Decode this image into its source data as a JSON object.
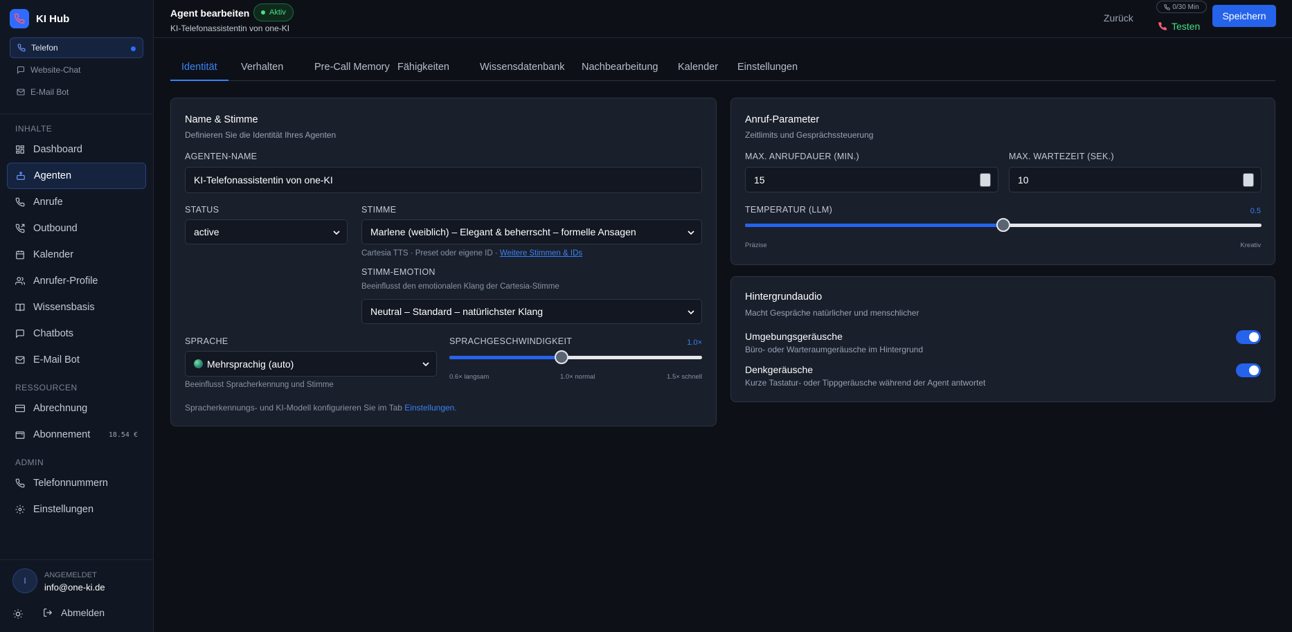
{
  "app": {
    "name": "KI Hub"
  },
  "channels": [
    {
      "label": "Telefon",
      "icon": "phone-icon"
    },
    {
      "label": "Website-Chat",
      "icon": "chat-icon"
    },
    {
      "label": "E-Mail Bot",
      "icon": "mail-icon"
    }
  ],
  "sidebar": {
    "sections": {
      "content": "INHALTE",
      "resources": "RESSOURCEN",
      "admin": "ADMIN"
    },
    "items": [
      {
        "label": "Dashboard"
      },
      {
        "label": "Agenten"
      },
      {
        "label": "Anrufe"
      },
      {
        "label": "Outbound"
      },
      {
        "label": "Kalender"
      },
      {
        "label": "Anrufer-Profile"
      },
      {
        "label": "Wissensbasis"
      },
      {
        "label": "Chatbots"
      },
      {
        "label": "E-Mail Bot"
      },
      {
        "label": "Abrechnung"
      },
      {
        "label": "Abonnement",
        "badge": "18.54 €"
      },
      {
        "label": "Telefonnummern"
      },
      {
        "label": "Einstellungen"
      }
    ],
    "account": {
      "avatar": "I",
      "label": "ANGEMELDET",
      "email": "info@one-ki.de",
      "logout": "Abmelden"
    }
  },
  "header": {
    "title": "Agent bearbeiten",
    "status_badge": "Aktiv",
    "subtitle": "KI-Telefonassistentin von one-KI",
    "back": "Zurück",
    "minutes": "0/30 Min",
    "test": "Testen",
    "save": "Speichern"
  },
  "tabs": [
    {
      "label": "Identität"
    },
    {
      "label": "Verhalten"
    },
    {
      "label": "Pre-Call Memory"
    },
    {
      "label": "Fähigkeiten"
    },
    {
      "label": "Wissensdatenbank"
    },
    {
      "label": "Nachbearbeitung"
    },
    {
      "label": "Kalender"
    },
    {
      "label": "Einstellungen"
    }
  ],
  "identity": {
    "title": "Name & Stimme",
    "subtitle": "Definieren Sie die Identität Ihres Agenten",
    "name_label": "AGENTEN-NAME",
    "name_value": "KI-Telefonassistentin von one-KI",
    "status_label": "STATUS",
    "status_value": "active",
    "voice_label": "STIMME",
    "voice_value": "Marlene (weiblich) – Elegant & beherrscht – formelle Ansagen",
    "voice_hint": "Cartesia TTS · Preset oder eigene ID · ",
    "voice_link": "Weitere Stimmen & IDs",
    "emotion_label": "STIMM-EMOTION",
    "emotion_hint": "Beeinflusst den emotionalen Klang der Cartesia-Stimme",
    "emotion_value": "Neutral – Standard – natürlichster Klang",
    "language_label": "SPRACHE",
    "language_value": "Mehrsprachig (auto)",
    "language_hint": "Beeinflusst Spracherkennung und Stimme",
    "speed_label": "SPRACHGESCHWINDIGKEIT",
    "speed_value": "1.0×",
    "speed_fraction": 0.444,
    "speed_min": "0.6× langsam",
    "speed_mid": "1.0× normal",
    "speed_max": "1.5× schnell",
    "footer_text": "Spracherkennungs- und KI-Modell konfigurieren Sie im Tab ",
    "footer_link": "Einstellungen."
  },
  "call_params": {
    "title": "Anruf-Parameter",
    "subtitle": "Zeitlimits und Gesprächssteuerung",
    "max_duration_label": "MAX. ANRUFDAUER (MIN.)",
    "max_duration_value": "15",
    "max_wait_label": "MAX. WARTEZEIT (SEK.)",
    "max_wait_value": "10",
    "temperature_label": "TEMPERATUR (LLM)",
    "temperature_value": "0.5",
    "temperature_fraction": 0.5,
    "temp_min": "Präzise",
    "temp_max": "Kreativ"
  },
  "background_audio": {
    "title": "Hintergrundaudio",
    "subtitle": "Macht Gespräche natürlicher und menschlicher",
    "ambient_title": "Umgebungsgeräusche",
    "ambient_sub": "Büro- oder Warteraumgeräusche im Hintergrund",
    "ambient_on": true,
    "thinking_title": "Denkgeräusche",
    "thinking_sub": "Kurze Tastatur- oder Tippgeräusche während der Agent antwortet",
    "thinking_on": true
  },
  "colors": {
    "accent": "#2563eb",
    "success": "#4ade80",
    "bg": "#0d1117",
    "card": "#191f2b"
  }
}
